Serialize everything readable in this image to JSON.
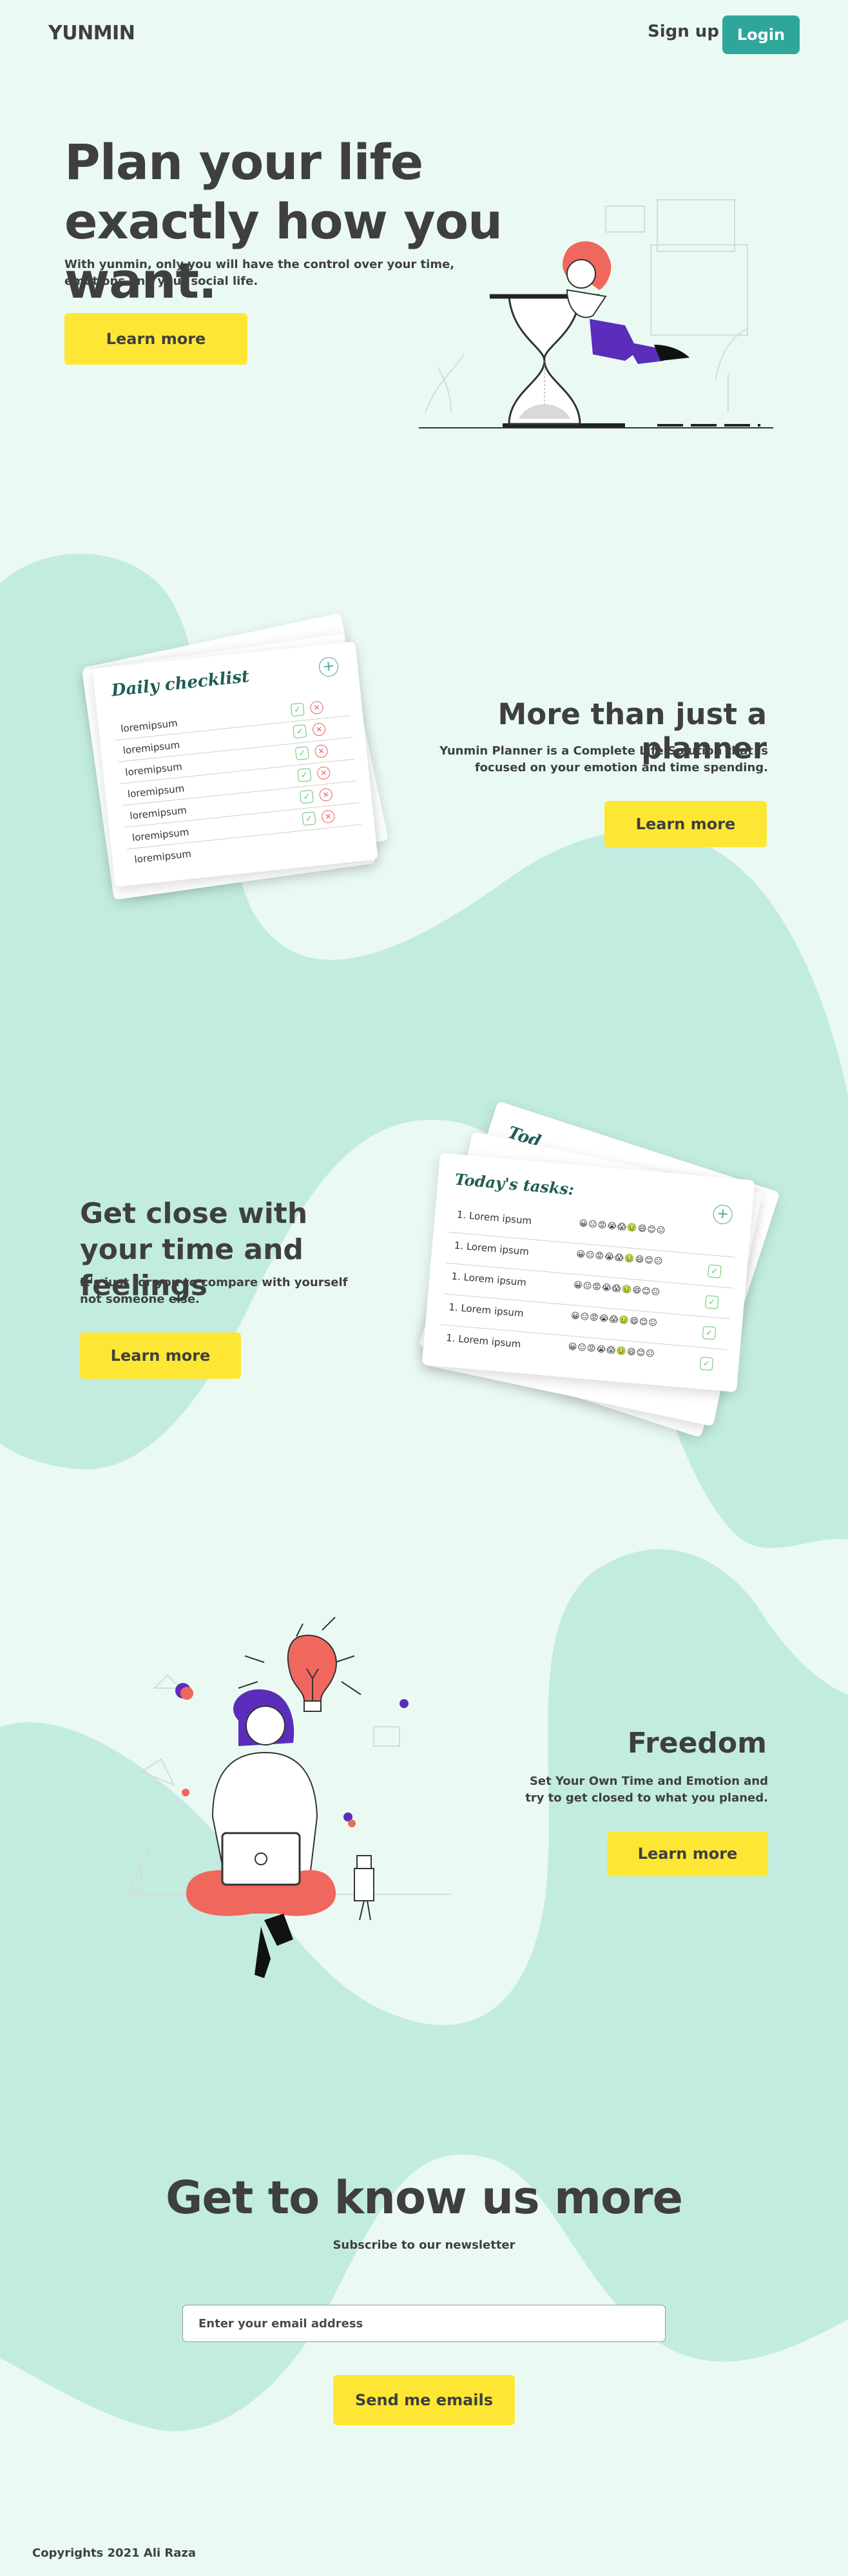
{
  "header": {
    "logo": "YUNMIN",
    "signup_label": "Sign up",
    "login_label": "Login"
  },
  "hero": {
    "title": "Plan your life exactly how you want.",
    "subtitle": "With yunmin, only you will have the control over your time, emotions and your social life.",
    "button_label": "Learn more"
  },
  "planner_section": {
    "title": "More than just a planner",
    "subtitle": "Yunmin Planner is a Complete Life Solution that is focused on your emotion and time spending.",
    "button_label": "Learn more",
    "card": {
      "title": "Daily checklist",
      "items": [
        "loremipsum",
        "loremipsum",
        "loremipsum",
        "loremipsum",
        "loremipsum",
        "loremipsum",
        "loremipsum"
      ]
    }
  },
  "feelings_section": {
    "title": "Get close with your time and feelings",
    "subtitle": "It's just for you to compare with yourself not someone else.",
    "button_label": "Learn more",
    "card": {
      "title": "Today's tasks:",
      "back_title": "Tod",
      "items": [
        "1. Lorem ipsum",
        "1. Lorem ipsum",
        "1. Lorem ipsum",
        "1. Lorem ipsum",
        "1. Lorem ipsum",
        "1. Lorem ipsum"
      ],
      "emoji_row": "😀😐😡😭😱🤢😄😊😐"
    }
  },
  "freedom_section": {
    "title": "Freedom",
    "subtitle": "Set Your Own Time and Emotion and try to get closed to what you planed.",
    "button_label": "Learn more"
  },
  "newsletter": {
    "title": "Get to know us more",
    "subtitle": "Subscribe to our newsletter",
    "input_placeholder": "Enter your email address",
    "input_value": "",
    "button_label": "Send me emails"
  },
  "footer": {
    "copyright": "Copyrights 2021 Ali Raza"
  },
  "colors": {
    "background": "#eafaf3",
    "blob": "#c3ece0",
    "primary": "#2ea79a",
    "accent_yellow": "#fde734",
    "text": "#3f3f3f"
  }
}
